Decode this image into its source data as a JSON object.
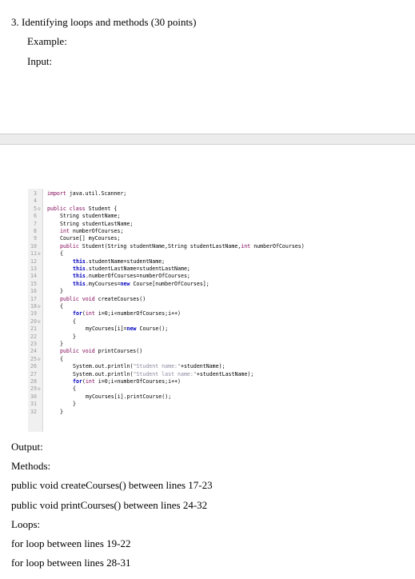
{
  "question": {
    "heading": "3.   Identifying loops and methods (30 points)",
    "example_label": "Example:",
    "input_label": "Input:"
  },
  "code": {
    "lines": [
      {
        "n": "3",
        "fold": "",
        "indent": 0,
        "parts": [
          {
            "t": "import",
            "c": "kw2"
          },
          {
            "t": " java.util.Scanner;",
            "c": ""
          }
        ]
      },
      {
        "n": "4",
        "fold": "",
        "indent": 0,
        "parts": []
      },
      {
        "n": "5",
        "fold": "⊖",
        "indent": 0,
        "parts": [
          {
            "t": "public class ",
            "c": "kw2"
          },
          {
            "t": "Student {",
            "c": ""
          }
        ]
      },
      {
        "n": "6",
        "fold": "",
        "indent": 1,
        "parts": [
          {
            "t": "String studentName;",
            "c": ""
          }
        ]
      },
      {
        "n": "7",
        "fold": "",
        "indent": 1,
        "parts": [
          {
            "t": "String studentLastName;",
            "c": ""
          }
        ]
      },
      {
        "n": "8",
        "fold": "",
        "indent": 1,
        "parts": [
          {
            "t": "int ",
            "c": "kw2"
          },
          {
            "t": "numberOfCourses;",
            "c": ""
          }
        ]
      },
      {
        "n": "9",
        "fold": "",
        "indent": 1,
        "parts": [
          {
            "t": "Course[] myCourses;",
            "c": ""
          }
        ]
      },
      {
        "n": "10",
        "fold": "",
        "indent": 1,
        "parts": [
          {
            "t": "public ",
            "c": "kw2"
          },
          {
            "t": "Student(String studentName,String studentLastName,",
            "c": ""
          },
          {
            "t": "int ",
            "c": "kw2"
          },
          {
            "t": "numberOfCourses)",
            "c": ""
          }
        ]
      },
      {
        "n": "11",
        "fold": "⊖",
        "indent": 1,
        "parts": [
          {
            "t": "{",
            "c": ""
          }
        ]
      },
      {
        "n": "12",
        "fold": "",
        "indent": 2,
        "parts": [
          {
            "t": "this",
            "c": "kw"
          },
          {
            "t": ".studentName=studentName;",
            "c": ""
          }
        ]
      },
      {
        "n": "13",
        "fold": "",
        "indent": 2,
        "parts": [
          {
            "t": "this",
            "c": "kw"
          },
          {
            "t": ".studentLastName=studentLastName;",
            "c": ""
          }
        ]
      },
      {
        "n": "14",
        "fold": "",
        "indent": 2,
        "parts": [
          {
            "t": "this",
            "c": "kw"
          },
          {
            "t": ".numberOfCourses=numberOfCourses;",
            "c": ""
          }
        ]
      },
      {
        "n": "15",
        "fold": "",
        "indent": 2,
        "parts": [
          {
            "t": "this",
            "c": "kw"
          },
          {
            "t": ".myCourses=",
            "c": ""
          },
          {
            "t": "new",
            "c": "kw"
          },
          {
            "t": " Course[numberOfCourses];",
            "c": ""
          }
        ]
      },
      {
        "n": "16",
        "fold": "",
        "indent": 1,
        "parts": [
          {
            "t": "}",
            "c": ""
          }
        ]
      },
      {
        "n": "17",
        "fold": "",
        "indent": 1,
        "parts": [
          {
            "t": "public void ",
            "c": "kw2"
          },
          {
            "t": "createCourses()",
            "c": ""
          }
        ]
      },
      {
        "n": "18",
        "fold": "⊖",
        "indent": 1,
        "parts": [
          {
            "t": "{",
            "c": ""
          }
        ]
      },
      {
        "n": "19",
        "fold": "",
        "indent": 2,
        "parts": [
          {
            "t": "for",
            "c": "kw"
          },
          {
            "t": "(",
            "c": ""
          },
          {
            "t": "int ",
            "c": "kw2"
          },
          {
            "t": "i=0;i<numberOfCourses;i++)",
            "c": ""
          }
        ]
      },
      {
        "n": "20",
        "fold": "⊖",
        "indent": 2,
        "parts": [
          {
            "t": "{",
            "c": ""
          }
        ]
      },
      {
        "n": "21",
        "fold": "",
        "indent": 3,
        "parts": [
          {
            "t": "myCourses[i]=",
            "c": ""
          },
          {
            "t": "new",
            "c": "kw"
          },
          {
            "t": " Course();",
            "c": ""
          }
        ]
      },
      {
        "n": "22",
        "fold": "",
        "indent": 2,
        "parts": [
          {
            "t": "}",
            "c": ""
          }
        ]
      },
      {
        "n": "23",
        "fold": "",
        "indent": 1,
        "parts": [
          {
            "t": "}",
            "c": ""
          }
        ]
      },
      {
        "n": "24",
        "fold": "",
        "indent": 1,
        "parts": [
          {
            "t": "public void ",
            "c": "kw2"
          },
          {
            "t": "printCourses()",
            "c": ""
          }
        ]
      },
      {
        "n": "25",
        "fold": "⊖",
        "indent": 1,
        "parts": [
          {
            "t": "{",
            "c": ""
          }
        ]
      },
      {
        "n": "26",
        "fold": "",
        "indent": 2,
        "parts": [
          {
            "t": "System.out.println(",
            "c": ""
          },
          {
            "t": "\"Student name:\"",
            "c": "str"
          },
          {
            "t": "+studentName);",
            "c": ""
          }
        ]
      },
      {
        "n": "27",
        "fold": "",
        "indent": 2,
        "parts": [
          {
            "t": "System.out.println(",
            "c": ""
          },
          {
            "t": "\"Student last name:\"",
            "c": "str"
          },
          {
            "t": "+studentLastName);",
            "c": ""
          }
        ]
      },
      {
        "n": "28",
        "fold": "",
        "indent": 2,
        "parts": [
          {
            "t": "for",
            "c": "kw"
          },
          {
            "t": "(",
            "c": ""
          },
          {
            "t": "int ",
            "c": "kw2"
          },
          {
            "t": "i=0;i<numberOfCourses;i++)",
            "c": ""
          }
        ]
      },
      {
        "n": "29",
        "fold": "⊖",
        "indent": 2,
        "parts": [
          {
            "t": "{",
            "c": ""
          }
        ]
      },
      {
        "n": "30",
        "fold": "",
        "indent": 3,
        "parts": [
          {
            "t": "myCourses[i].printCourse();",
            "c": ""
          }
        ]
      },
      {
        "n": "31",
        "fold": "",
        "indent": 2,
        "parts": [
          {
            "t": "}",
            "c": ""
          }
        ]
      },
      {
        "n": "32",
        "fold": "",
        "indent": 1,
        "parts": [
          {
            "t": "}",
            "c": ""
          }
        ]
      }
    ]
  },
  "answer": {
    "output_label": "Output:",
    "methods_label": "Methods:",
    "method1": "public void createCourses() between lines 17-23",
    "method2": "public void printCourses() between lines 24-32",
    "loops_label": "Loops:",
    "loop1": "for loop between lines 19-22",
    "loop2": "for loop between lines 28-31"
  }
}
